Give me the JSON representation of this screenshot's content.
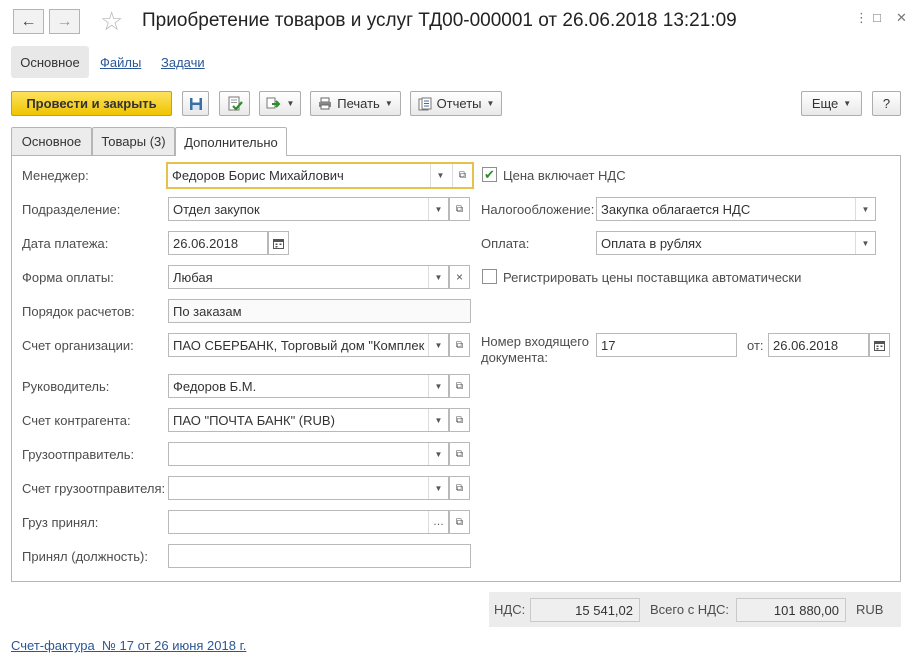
{
  "header": {
    "title": "Приобретение товаров и услуг ТД00-000001 от 26.06.2018 13:21:09",
    "back": "←",
    "forward": "→",
    "star": "☆",
    "window_more": "⋮",
    "window_resize": "□",
    "window_close": "✕"
  },
  "sections": {
    "main": "Основное",
    "files": "Файлы",
    "tasks": "Задачи"
  },
  "toolbar": {
    "post_close": "Провести и закрыть",
    "print": "Печать",
    "reports": "Отчеты",
    "more": "Еще",
    "help": "?"
  },
  "tabs": [
    {
      "label": "Основное"
    },
    {
      "label": "Товары (3)"
    },
    {
      "label": "Дополнительно"
    }
  ],
  "form": {
    "manager": {
      "label": "Менеджер:",
      "value": "Федоров Борис Михайлович"
    },
    "department": {
      "label": "Подразделение:",
      "value": "Отдел закупок"
    },
    "payment_date": {
      "label": "Дата платежа:",
      "value": "26.06.2018"
    },
    "payment_form": {
      "label": "Форма оплаты:",
      "value": "Любая"
    },
    "settlement_order": {
      "label": "Порядок расчетов:",
      "value": "По заказам"
    },
    "org_account": {
      "label": "Счет организации:",
      "value": "ПАО СБЕРБАНК, Торговый дом \"Комплек"
    },
    "director": {
      "label": "Руководитель:",
      "value": "Федоров Б.М."
    },
    "contractor_account": {
      "label": "Счет контрагента:",
      "value": "ПАО \"ПОЧТА БАНК\" (RUB)"
    },
    "shipper": {
      "label": "Грузоотправитель:",
      "value": ""
    },
    "shipper_account": {
      "label": "Счет грузоотправителя:",
      "value": ""
    },
    "cargo_received": {
      "label": "Груз принял:",
      "value": ""
    },
    "received_position": {
      "label": "Принял (должность):",
      "value": ""
    },
    "price_includes_vat": {
      "label": "Цена включает НДС",
      "checked": true
    },
    "taxation": {
      "label": "Налогообложение:",
      "value": "Закупка облагается НДС"
    },
    "payment": {
      "label": "Оплата:",
      "value": "Оплата в рублях"
    },
    "register_prices": {
      "label": "Регистрировать цены поставщика автоматически",
      "checked": false
    },
    "incoming_doc": {
      "label_line1": "Номер входящего",
      "label_line2": "документа:",
      "value": "17"
    },
    "incoming_date": {
      "label": "от:",
      "value": "26.06.2018"
    }
  },
  "totals": {
    "vat_label": "НДС:",
    "vat_value": "15 541,02",
    "total_label": "Всего с НДС:",
    "total_value": "101 880,00",
    "currency": "RUB"
  },
  "footer": {
    "invoice_link": "Счет-фактура  № 17 от 26 июня 2018 г."
  },
  "colors": {
    "primary_button": "#f5d000",
    "link": "#2b5797",
    "focus_border": "#e5c34a",
    "check": "#2e8b2e"
  },
  "icons": {
    "save": "save-icon",
    "post": "post-document-icon",
    "create_based": "create-based-on-icon",
    "print": "printer-icon",
    "reports": "reports-icon",
    "calendar": "calendar-icon"
  }
}
